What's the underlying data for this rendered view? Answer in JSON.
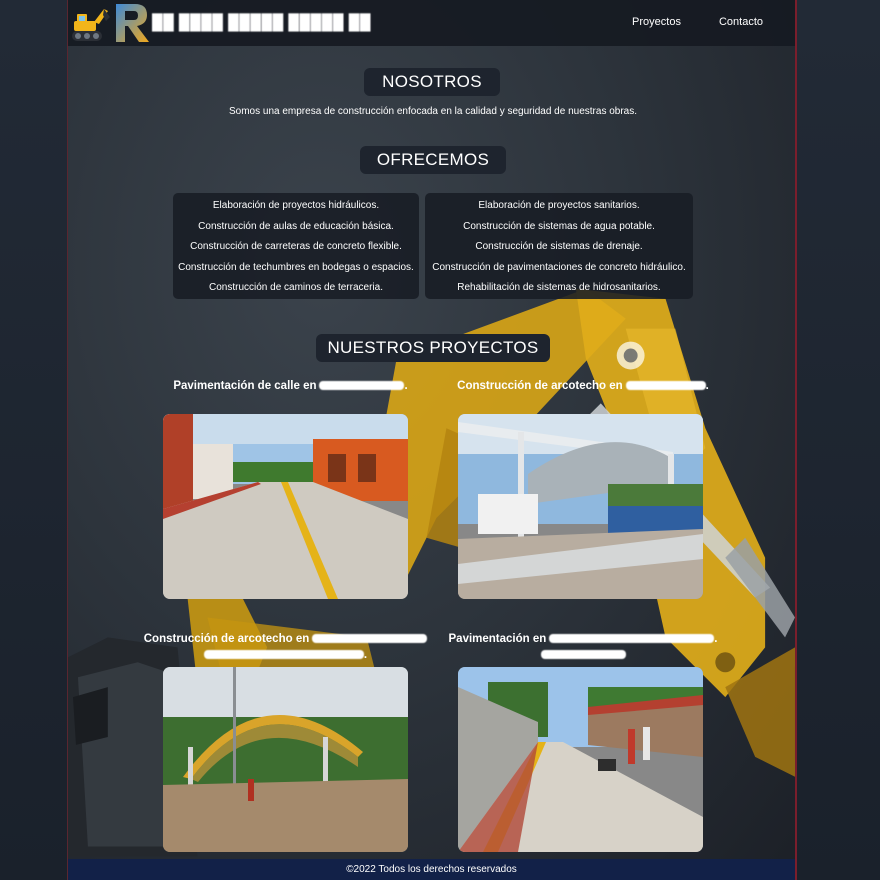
{
  "header": {
    "brand_name": "██ ████ █████ █████ ██",
    "nav": [
      "Proyectos",
      "Contacto"
    ]
  },
  "about": {
    "title": "NOSOTROS",
    "text": "Somos una empresa de construcción enfocada en la calidad y seguridad de nuestras obras."
  },
  "offer": {
    "title": "OFRECEMOS",
    "left": [
      "Elaboración de proyectos hidráulicos.",
      "Construcción de aulas de educación básica.",
      "Construcción de carreteras de concreto flexible.",
      "Construcción de techumbres en bodegas o espacios.",
      "Construcción de caminos de terraceria."
    ],
    "right": [
      "Elaboración de proyectos sanitarios.",
      "Construcción de sistemas de agua potable.",
      "Construcción de sistemas de drenaje.",
      "Construcción de pavimentaciones de concreto hidráulico.",
      "Rehabilitación de sistemas de hidrosanitarios."
    ]
  },
  "projects": {
    "title": "NUESTROS PROYECTOS",
    "items": [
      {
        "title": "Pavimentación de calle en",
        "suffix": "."
      },
      {
        "title": "Construcción de arcotecho en",
        "suffix": "."
      },
      {
        "title": "Construcción de arcotecho en",
        "suffix": "."
      },
      {
        "title": "Pavimentación en",
        "suffix": "."
      }
    ]
  },
  "footer": {
    "text": "©2022 Todos los derechos reservados"
  },
  "colors": {
    "accent_yellow": "#e9b318",
    "footer_blue": "#122148",
    "border_red": "#7a1e2c"
  }
}
